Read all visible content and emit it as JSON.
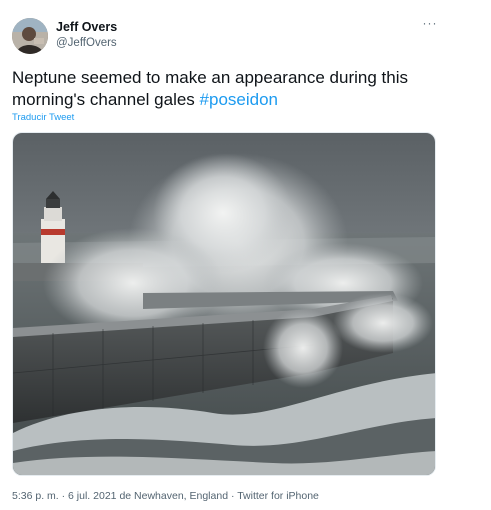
{
  "author": {
    "display_name": "Jeff Overs",
    "handle": "@JeffOvers",
    "avatar_icon": "user-avatar"
  },
  "more_icon": "more-options-icon",
  "more_glyph": "···",
  "tweet": {
    "text_part1": "Neptune seemed to make an appearance during this morning's channel gales ",
    "hashtag": "#poseidon",
    "translate_label": "Traducir Tweet"
  },
  "media": {
    "kind": "photo",
    "subject": "storm-waves-over-harbour-wall-with-lighthouse"
  },
  "meta": {
    "time": "5:36 p. m.",
    "date": "6 jul. 2021",
    "location_prefix": "de",
    "location": "Newhaven, England",
    "source": "Twitter for iPhone",
    "separator": " · "
  },
  "colors": {
    "link": "#1d9bf0",
    "secondary_text": "#536471",
    "primary_text": "#0f1419"
  }
}
